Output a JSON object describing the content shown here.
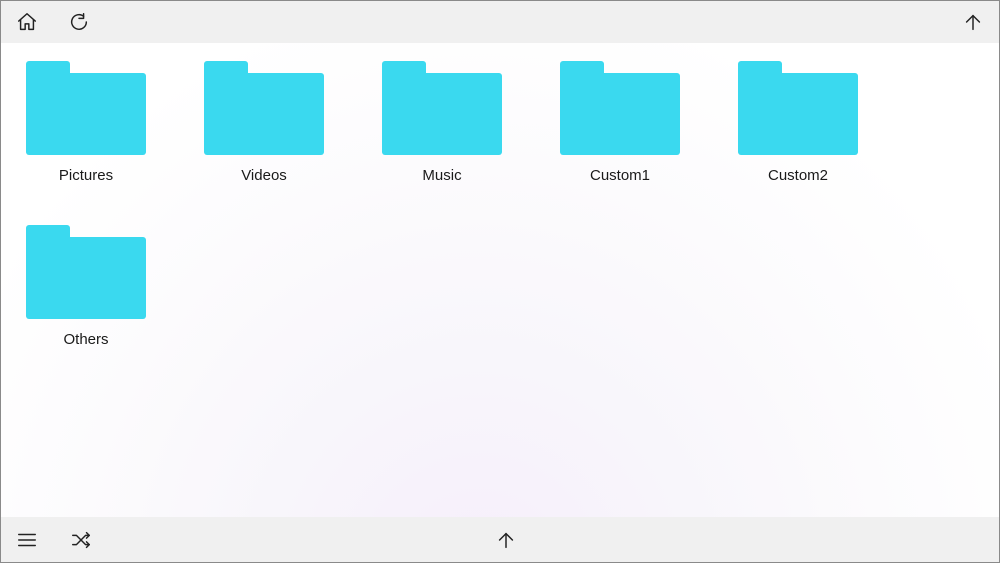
{
  "folders": [
    {
      "label": "Pictures"
    },
    {
      "label": "Videos"
    },
    {
      "label": "Music"
    },
    {
      "label": "Custom1"
    },
    {
      "label": "Custom2"
    },
    {
      "label": "Others"
    }
  ],
  "icons": {
    "home": "home-icon",
    "refresh": "refresh-icon",
    "up_top": "arrow-up-icon",
    "menu": "menu-icon",
    "shuffle": "shuffle-icon",
    "up_bottom": "arrow-up-icon"
  },
  "colors": {
    "folder": "#3ad9ef",
    "toolbar_bg": "#f0f0f0"
  }
}
